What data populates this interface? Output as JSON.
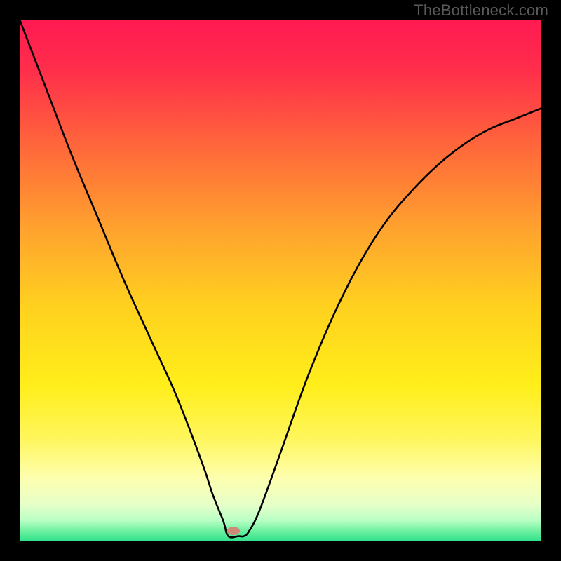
{
  "watermark": "TheBottleneck.com",
  "chart_data": {
    "type": "line",
    "title": "",
    "xlabel": "",
    "ylabel": "",
    "xlim": [
      0,
      100
    ],
    "ylim": [
      0,
      100
    ],
    "grid": false,
    "legend": false,
    "background_bands_vertical_pct": {
      "red_top": 0,
      "orange_mid": 50,
      "yellow": 75,
      "pale_yellow": 86,
      "green_bottom": 97
    },
    "series": [
      {
        "name": "bottleneck-curve",
        "color": "#000000",
        "x": [
          0,
          5,
          10,
          15,
          20,
          25,
          30,
          35,
          37,
          39,
          40,
          42,
          43,
          44,
          46,
          50,
          55,
          60,
          65,
          70,
          75,
          80,
          85,
          90,
          95,
          100
        ],
        "values": [
          100,
          87,
          74,
          62,
          50,
          39,
          28,
          15,
          9,
          4,
          1,
          1,
          1,
          2,
          6,
          17,
          31,
          43,
          53,
          61,
          67,
          72,
          76,
          79,
          81,
          83
        ]
      }
    ],
    "marker": {
      "x_pct": 41,
      "y_pct_from_bottom": 2,
      "color": "#d08878",
      "rx": 9,
      "ry": 6
    }
  }
}
